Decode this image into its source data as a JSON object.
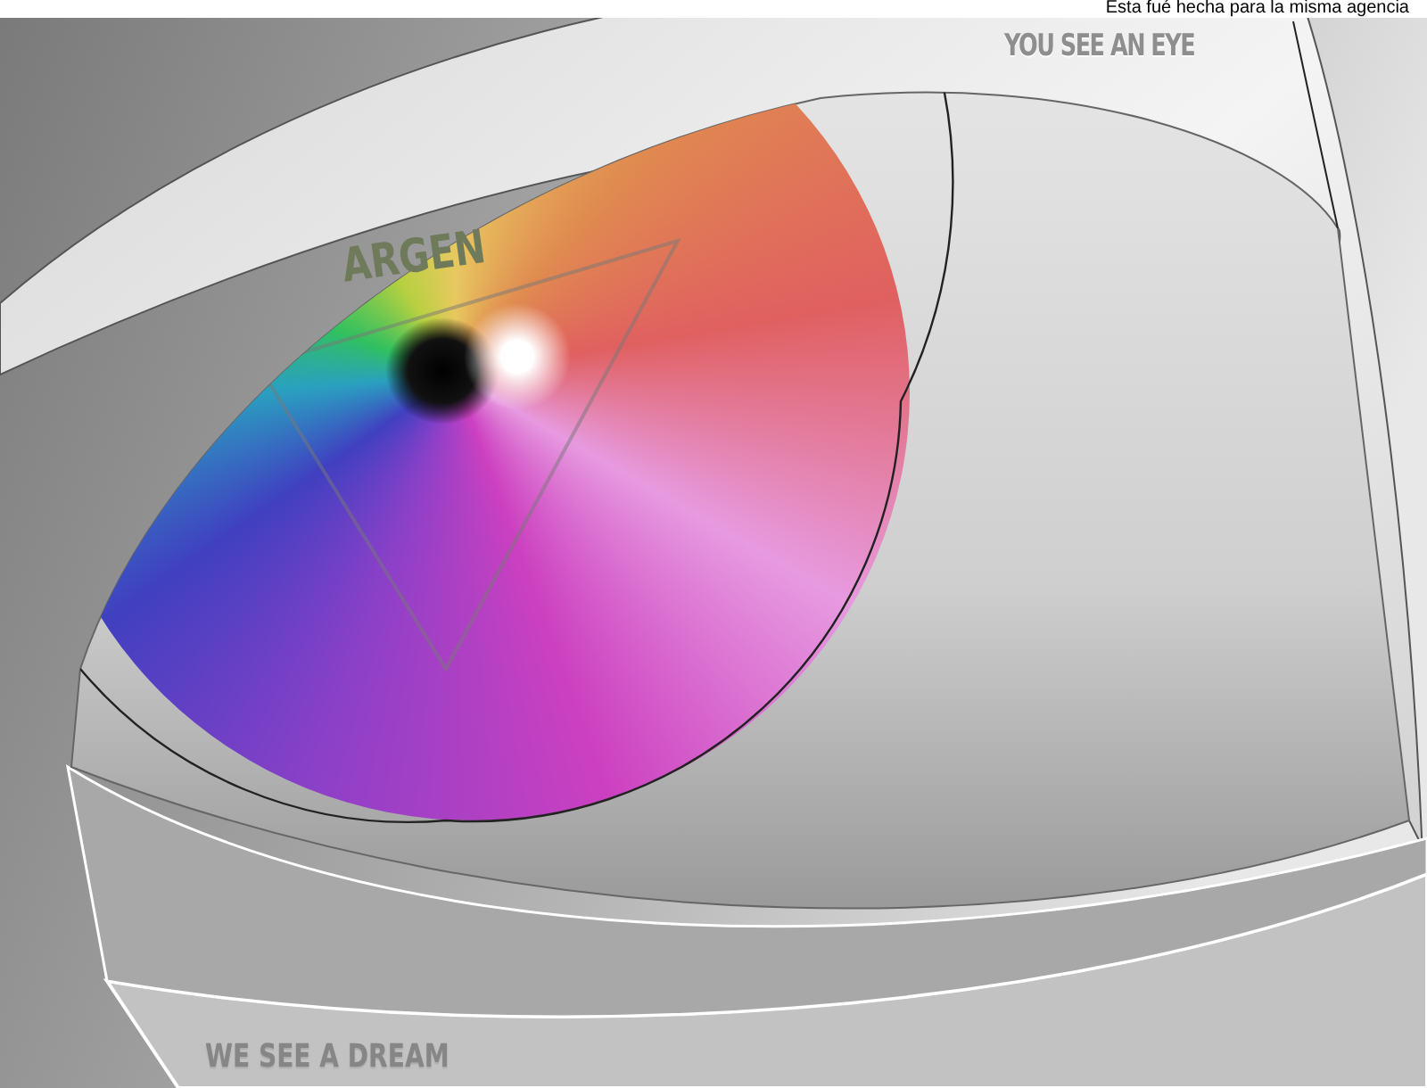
{
  "caption": "Esta fué hecha para la misma agencia",
  "artwork": {
    "top_slogan": "YOU SEE AN EYE",
    "logo_text": "ARGEN",
    "bottom_slogan": "WE SEE A DREAM"
  }
}
